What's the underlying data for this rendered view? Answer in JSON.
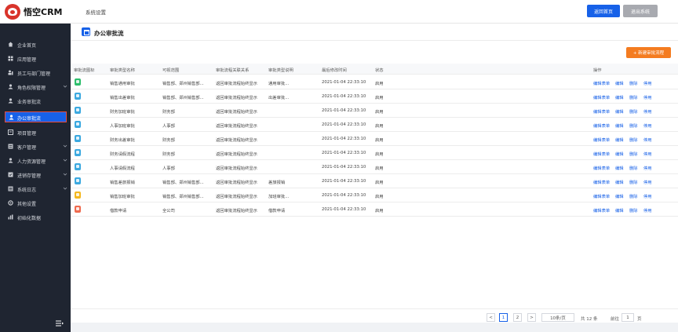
{
  "header": {
    "logo_text": "悟空CRM",
    "page_label": "系统设置",
    "home_button": "返回首页",
    "logout_button": "退出系统"
  },
  "colors": {
    "primary": "#1761e8",
    "sidebar_bg": "#1f2531",
    "accent_orange": "#f47c20",
    "logo_red": "#d9342b"
  },
  "sidebar": {
    "items": [
      {
        "label": "企业首页",
        "icon": "home-icon",
        "has_children": false
      },
      {
        "label": "应用管理",
        "icon": "apps-icon",
        "has_children": false
      },
      {
        "label": "员工与部门管理",
        "icon": "org-icon",
        "has_children": false
      },
      {
        "label": "角色权限管理",
        "icon": "role-icon",
        "has_children": true
      },
      {
        "label": "业务审批流",
        "icon": "approval-icon",
        "has_children": false
      },
      {
        "label": "办公审批流",
        "icon": "office-approval-icon",
        "has_children": false,
        "active": true
      },
      {
        "label": "项目管理",
        "icon": "project-icon",
        "has_children": false
      },
      {
        "label": "客户管理",
        "icon": "customer-icon",
        "has_children": true
      },
      {
        "label": "人力资源管理",
        "icon": "hr-icon",
        "has_children": true
      },
      {
        "label": "进销存管理",
        "icon": "inventory-icon",
        "has_children": true
      },
      {
        "label": "系统日志",
        "icon": "log-icon",
        "has_children": true
      },
      {
        "label": "其他设置",
        "icon": "settings-icon",
        "has_children": false
      },
      {
        "label": "初始化数据",
        "icon": "chart-icon",
        "has_children": false
      }
    ]
  },
  "main": {
    "title": "办公审批流",
    "new_button": "+ 新建审批流程",
    "columns": [
      "审批流图标",
      "审批类型名称",
      "可视范围",
      "审批流程关联关系",
      "审批类型说明",
      "最后修改时间",
      "状态",
      "操作"
    ],
    "rows": [
      {
        "icon_color": "#2dbe6c",
        "name": "销售通用审批",
        "scope": "销售部、郑州销售部...",
        "flow": "返回审批流程始终显示",
        "desc": "通用审批...",
        "time": "2021-01-04 22:33:10",
        "status": "启用"
      },
      {
        "icon_color": "#3ca9e0",
        "name": "销售出差审批",
        "scope": "销售部、郑州销售部...",
        "flow": "返回审批流程始终显示",
        "desc": "出差审批...",
        "time": "2021-01-04 22:33:10",
        "status": "启用"
      },
      {
        "icon_color": "#3ca9e0",
        "name": "财务加班审批",
        "scope": "财务部",
        "flow": "返回审批流程始终显示",
        "desc": "",
        "time": "2021-01-04 22:33:10",
        "status": "启用"
      },
      {
        "icon_color": "#3ca9e0",
        "name": "人事加班审批",
        "scope": "人事部",
        "flow": "返回审批流程始终显示",
        "desc": "",
        "time": "2021-01-04 22:33:10",
        "status": "启用"
      },
      {
        "icon_color": "#3ca9e0",
        "name": "财务出差审批",
        "scope": "财务部",
        "flow": "返回审批流程始终显示",
        "desc": "",
        "time": "2021-01-04 22:33:10",
        "status": "启用"
      },
      {
        "icon_color": "#3ca9e0",
        "name": "财务请假流程",
        "scope": "财务部",
        "flow": "返回审批流程始终显示",
        "desc": "",
        "time": "2021-01-04 22:33:10",
        "status": "启用"
      },
      {
        "icon_color": "#3ca9e0",
        "name": "人事请假流程",
        "scope": "人事部",
        "flow": "返回审批流程始终显示",
        "desc": "",
        "time": "2021-01-04 22:33:10",
        "status": "启用"
      },
      {
        "icon_color": "#3ca9e0",
        "name": "销售差旅报销",
        "scope": "销售部、郑州销售部...",
        "flow": "返回审批流程始终显示",
        "desc": "差旅报销",
        "time": "2021-01-04 22:33:10",
        "status": "启用"
      },
      {
        "icon_color": "#f5b81f",
        "name": "销售加班审批",
        "scope": "销售部、郑州销售部...",
        "flow": "返回审批流程始终显示",
        "desc": "加班审批...",
        "time": "2021-01-04 22:33:10",
        "status": "启用"
      },
      {
        "icon_color": "#ef6b4f",
        "name": "借款申请",
        "scope": "全公司",
        "flow": "返回审批流程始终显示",
        "desc": "借款申请",
        "time": "2021-01-04 22:33:10",
        "status": "启用"
      }
    ],
    "row_actions": [
      "编辑表单",
      "编辑",
      "删除",
      "停用"
    ]
  },
  "pagination": {
    "prev": "<",
    "pages": [
      "1",
      "2"
    ],
    "current": "1",
    "next": ">",
    "page_size": "10条/页",
    "total": "共 12 条",
    "goto_label": "前往",
    "goto_value": "1",
    "page_unit": "页"
  }
}
